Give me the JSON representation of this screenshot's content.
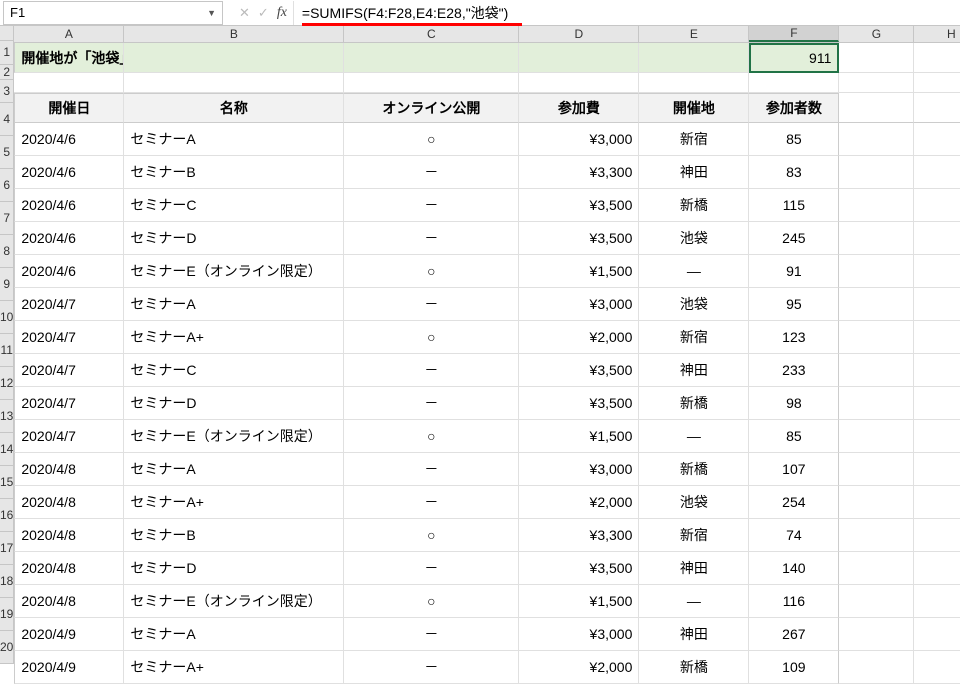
{
  "nameBox": "F1",
  "formula": "=SUMIFS(F4:F28,E4:E28,\"池袋\")",
  "columns": [
    "A",
    "B",
    "C",
    "D",
    "E",
    "F",
    "G",
    "H"
  ],
  "row1": {
    "title": "開催地が「池袋」の参加者数を合計する",
    "result": "911"
  },
  "headers": {
    "A": "開催日",
    "B": "名称",
    "C": "オンライン公開",
    "D": "参加費",
    "E": "開催地",
    "F": "参加者数"
  },
  "rows": [
    {
      "n": 4,
      "date": "2020/4/6",
      "name": "セミナーA",
      "online": "○",
      "fee": "¥3,000",
      "loc": "新宿",
      "cnt": "85"
    },
    {
      "n": 5,
      "date": "2020/4/6",
      "name": "セミナーB",
      "online": "－",
      "fee": "¥3,300",
      "loc": "神田",
      "cnt": "83"
    },
    {
      "n": 6,
      "date": "2020/4/6",
      "name": "セミナーC",
      "online": "－",
      "fee": "¥3,500",
      "loc": "新橋",
      "cnt": "115"
    },
    {
      "n": 7,
      "date": "2020/4/6",
      "name": "セミナーD",
      "online": "－",
      "fee": "¥3,500",
      "loc": "池袋",
      "cnt": "245"
    },
    {
      "n": 8,
      "date": "2020/4/6",
      "name": "セミナーE（オンライン限定）",
      "online": "○",
      "fee": "¥1,500",
      "loc": "―",
      "cnt": "91"
    },
    {
      "n": 9,
      "date": "2020/4/7",
      "name": "セミナーA",
      "online": "－",
      "fee": "¥3,000",
      "loc": "池袋",
      "cnt": "95"
    },
    {
      "n": 10,
      "date": "2020/4/7",
      "name": "セミナーA+",
      "online": "○",
      "fee": "¥2,000",
      "loc": "新宿",
      "cnt": "123"
    },
    {
      "n": 11,
      "date": "2020/4/7",
      "name": "セミナーC",
      "online": "－",
      "fee": "¥3,500",
      "loc": "神田",
      "cnt": "233"
    },
    {
      "n": 12,
      "date": "2020/4/7",
      "name": "セミナーD",
      "online": "－",
      "fee": "¥3,500",
      "loc": "新橋",
      "cnt": "98"
    },
    {
      "n": 13,
      "date": "2020/4/7",
      "name": "セミナーE（オンライン限定）",
      "online": "○",
      "fee": "¥1,500",
      "loc": "―",
      "cnt": "85"
    },
    {
      "n": 14,
      "date": "2020/4/8",
      "name": "セミナーA",
      "online": "－",
      "fee": "¥3,000",
      "loc": "新橋",
      "cnt": "107"
    },
    {
      "n": 15,
      "date": "2020/4/8",
      "name": "セミナーA+",
      "online": "－",
      "fee": "¥2,000",
      "loc": "池袋",
      "cnt": "254"
    },
    {
      "n": 16,
      "date": "2020/4/8",
      "name": "セミナーB",
      "online": "○",
      "fee": "¥3,300",
      "loc": "新宿",
      "cnt": "74"
    },
    {
      "n": 17,
      "date": "2020/4/8",
      "name": "セミナーD",
      "online": "－",
      "fee": "¥3,500",
      "loc": "神田",
      "cnt": "140"
    },
    {
      "n": 18,
      "date": "2020/4/8",
      "name": "セミナーE（オンライン限定）",
      "online": "○",
      "fee": "¥1,500",
      "loc": "―",
      "cnt": "116"
    },
    {
      "n": 19,
      "date": "2020/4/9",
      "name": "セミナーA",
      "online": "－",
      "fee": "¥3,000",
      "loc": "神田",
      "cnt": "267"
    },
    {
      "n": 20,
      "date": "2020/4/9",
      "name": "セミナーA+",
      "online": "－",
      "fee": "¥2,000",
      "loc": "新橋",
      "cnt": "109"
    }
  ]
}
